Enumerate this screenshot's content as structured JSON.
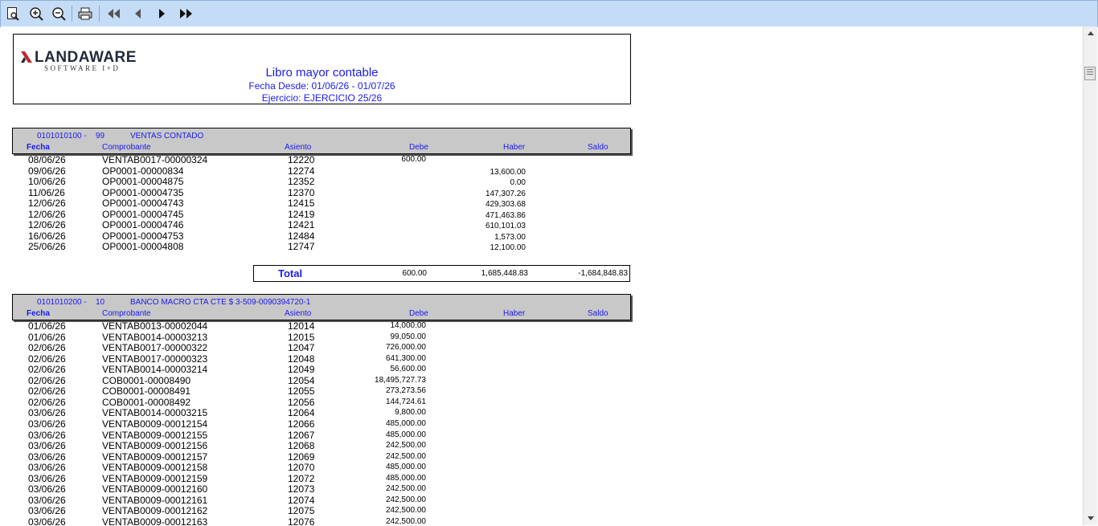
{
  "toolbar": {
    "buttons": [
      "page-preview-icon",
      "zoom-in-icon",
      "zoom-out-icon",
      "print-icon",
      "first-page-icon",
      "previous-page-icon",
      "next-page-icon",
      "last-page-icon"
    ]
  },
  "report": {
    "logo_name": "LANDAWARE",
    "logo_tagline": "SOFTWARE I+D",
    "title": "Libro mayor contable",
    "date_range": "Fecha Desde: 01/06/26 - 01/07/26",
    "fiscal_year": "Ejercicio: EJERCICIO 25/26",
    "columns": {
      "fecha": "Fecha",
      "comprobante": "Comprobante",
      "asiento": "Asiento",
      "debe": "Debe",
      "haber": "Haber",
      "saldo": "Saldo"
    }
  },
  "accounts": [
    {
      "code": "0101010100 -",
      "number": "99",
      "name": "VENTAS CONTADO",
      "rows": [
        {
          "fecha": "08/06/26",
          "comprobante": "VENTAB0017-00000324",
          "asiento": "12220",
          "debe": "600.00",
          "haber": ""
        },
        {
          "fecha": "09/06/26",
          "comprobante": "OP0001-00000834",
          "asiento": "12274",
          "debe": "",
          "haber": "13,600.00"
        },
        {
          "fecha": "10/06/26",
          "comprobante": "OP0001-00004875",
          "asiento": "12352",
          "debe": "",
          "haber": "0.00"
        },
        {
          "fecha": "11/06/26",
          "comprobante": "OP0001-00004735",
          "asiento": "12370",
          "debe": "",
          "haber": "147,307.26"
        },
        {
          "fecha": "12/06/26",
          "comprobante": "OP0001-00004743",
          "asiento": "12415",
          "debe": "",
          "haber": "429,303.68"
        },
        {
          "fecha": "12/06/26",
          "comprobante": "OP0001-00004745",
          "asiento": "12419",
          "debe": "",
          "haber": "471,463.86"
        },
        {
          "fecha": "12/06/26",
          "comprobante": "OP0001-00004746",
          "asiento": "12421",
          "debe": "",
          "haber": "610,101.03"
        },
        {
          "fecha": "16/06/26",
          "comprobante": "OP0001-00004753",
          "asiento": "12484",
          "debe": "",
          "haber": "1,573.00"
        },
        {
          "fecha": "25/06/26",
          "comprobante": "OP0001-00004808",
          "asiento": "12747",
          "debe": "",
          "haber": "12,100.00"
        }
      ],
      "total": {
        "label": "Total",
        "debe": "600.00",
        "haber": "1,685,448.83",
        "saldo": "-1,684,848.83"
      }
    },
    {
      "code": "0101010200 -",
      "number": "10",
      "name": "BANCO MACRO CTA CTE $ 3-509-0090394720-1",
      "rows": [
        {
          "fecha": "01/06/26",
          "comprobante": "VENTAB0013-00002044",
          "asiento": "12014",
          "debe": "14,000.00",
          "haber": ""
        },
        {
          "fecha": "01/06/26",
          "comprobante": "VENTAB0014-00003213",
          "asiento": "12015",
          "debe": "99,050.00",
          "haber": ""
        },
        {
          "fecha": "02/06/26",
          "comprobante": "VENTAB0017-00000322",
          "asiento": "12047",
          "debe": "726,000.00",
          "haber": ""
        },
        {
          "fecha": "02/06/26",
          "comprobante": "VENTAB0017-00000323",
          "asiento": "12048",
          "debe": "641,300.00",
          "haber": ""
        },
        {
          "fecha": "02/06/26",
          "comprobante": "VENTAB0014-00003214",
          "asiento": "12049",
          "debe": "56,600.00",
          "haber": ""
        },
        {
          "fecha": "02/06/26",
          "comprobante": "COB0001-00008490",
          "asiento": "12054",
          "debe": "18,495,727.73",
          "haber": ""
        },
        {
          "fecha": "02/06/26",
          "comprobante": "COB0001-00008491",
          "asiento": "12055",
          "debe": "273,273.56",
          "haber": ""
        },
        {
          "fecha": "02/06/26",
          "comprobante": "COB0001-00008492",
          "asiento": "12056",
          "debe": "144,724.61",
          "haber": ""
        },
        {
          "fecha": "03/06/26",
          "comprobante": "VENTAB0014-00003215",
          "asiento": "12064",
          "debe": "9,800.00",
          "haber": ""
        },
        {
          "fecha": "03/06/26",
          "comprobante": "VENTAB0009-00012154",
          "asiento": "12066",
          "debe": "485,000.00",
          "haber": ""
        },
        {
          "fecha": "03/06/26",
          "comprobante": "VENTAB0009-00012155",
          "asiento": "12067",
          "debe": "485,000.00",
          "haber": ""
        },
        {
          "fecha": "03/06/26",
          "comprobante": "VENTAB0009-00012156",
          "asiento": "12068",
          "debe": "242,500.00",
          "haber": ""
        },
        {
          "fecha": "03/06/26",
          "comprobante": "VENTAB0009-00012157",
          "asiento": "12069",
          "debe": "242,500.00",
          "haber": ""
        },
        {
          "fecha": "03/06/26",
          "comprobante": "VENTAB0009-00012158",
          "asiento": "12070",
          "debe": "485,000.00",
          "haber": ""
        },
        {
          "fecha": "03/06/26",
          "comprobante": "VENTAB0009-00012159",
          "asiento": "12072",
          "debe": "485,000.00",
          "haber": ""
        },
        {
          "fecha": "03/06/26",
          "comprobante": "VENTAB0009-00012160",
          "asiento": "12073",
          "debe": "242,500.00",
          "haber": ""
        },
        {
          "fecha": "03/06/26",
          "comprobante": "VENTAB0009-00012161",
          "asiento": "12074",
          "debe": "242,500.00",
          "haber": ""
        },
        {
          "fecha": "03/06/26",
          "comprobante": "VENTAB0009-00012162",
          "asiento": "12075",
          "debe": "242,500.00",
          "haber": ""
        },
        {
          "fecha": "03/06/26",
          "comprobante": "VENTAB0009-00012163",
          "asiento": "12076",
          "debe": "242,500.00",
          "haber": ""
        }
      ]
    }
  ],
  "colors": {
    "accent": "#1a1aee",
    "toolbar": "#c5dcf7",
    "header_band": "#c8c8c8",
    "logo_mark": "#c0282d"
  }
}
